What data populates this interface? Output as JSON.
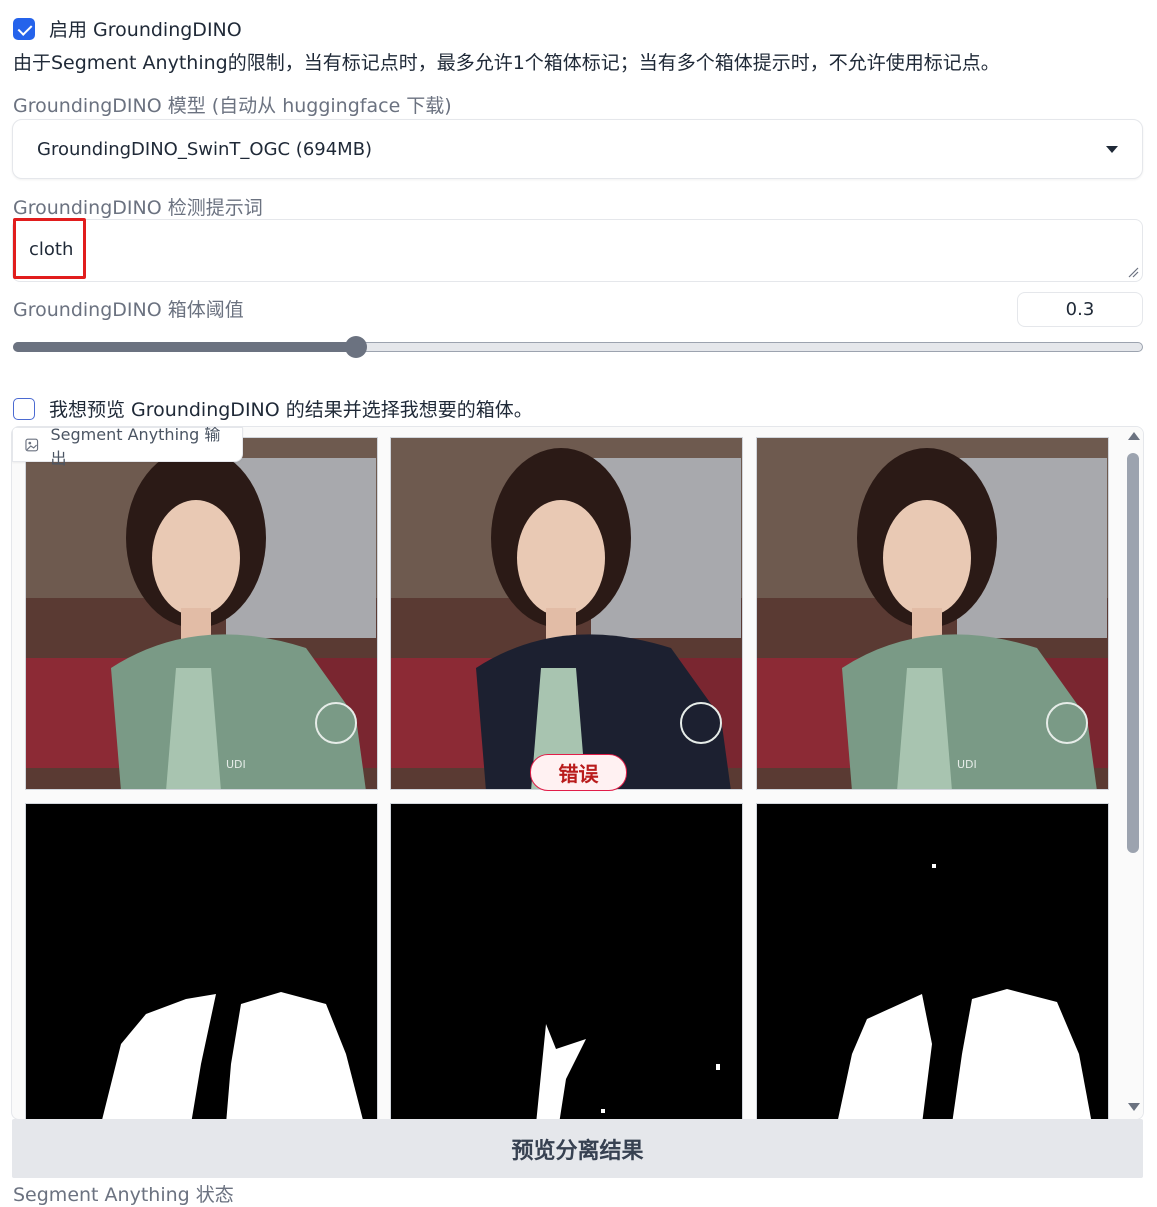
{
  "enable_grounding": {
    "label": "启用 GroundingDINO",
    "checked": true
  },
  "limit_note": "由于Segment Anything的限制，当有标记点时，最多允许1个箱体标记；当有多个箱体提示时，不允许使用标记点。",
  "model": {
    "label": "GroundingDINO 模型 (自动从 huggingface 下载)",
    "value": "GroundingDINO_SwinT_OGC (694MB)"
  },
  "prompt": {
    "label": "GroundingDINO 检测提示词",
    "value": "cloth"
  },
  "threshold": {
    "label": "GroundingDINO 箱体阈值",
    "value": "0.3",
    "fraction": 0.3
  },
  "preview_boxes": {
    "label": "我想预览 GroundingDINO 的结果并选择我想要的箱体。",
    "checked": false
  },
  "gallery": {
    "tag": "Segment Anything 输出",
    "error_label": "错误",
    "items": [
      "blended-green-jacket",
      "original-photo",
      "blended-green-jacket",
      "mask",
      "mask",
      "mask"
    ]
  },
  "preview_button": "预览分离结果",
  "status_label": "Segment Anything 状态",
  "colors": {
    "accent": "#2563eb",
    "error": "#e11d48",
    "highlight_box": "#e11d1d"
  }
}
